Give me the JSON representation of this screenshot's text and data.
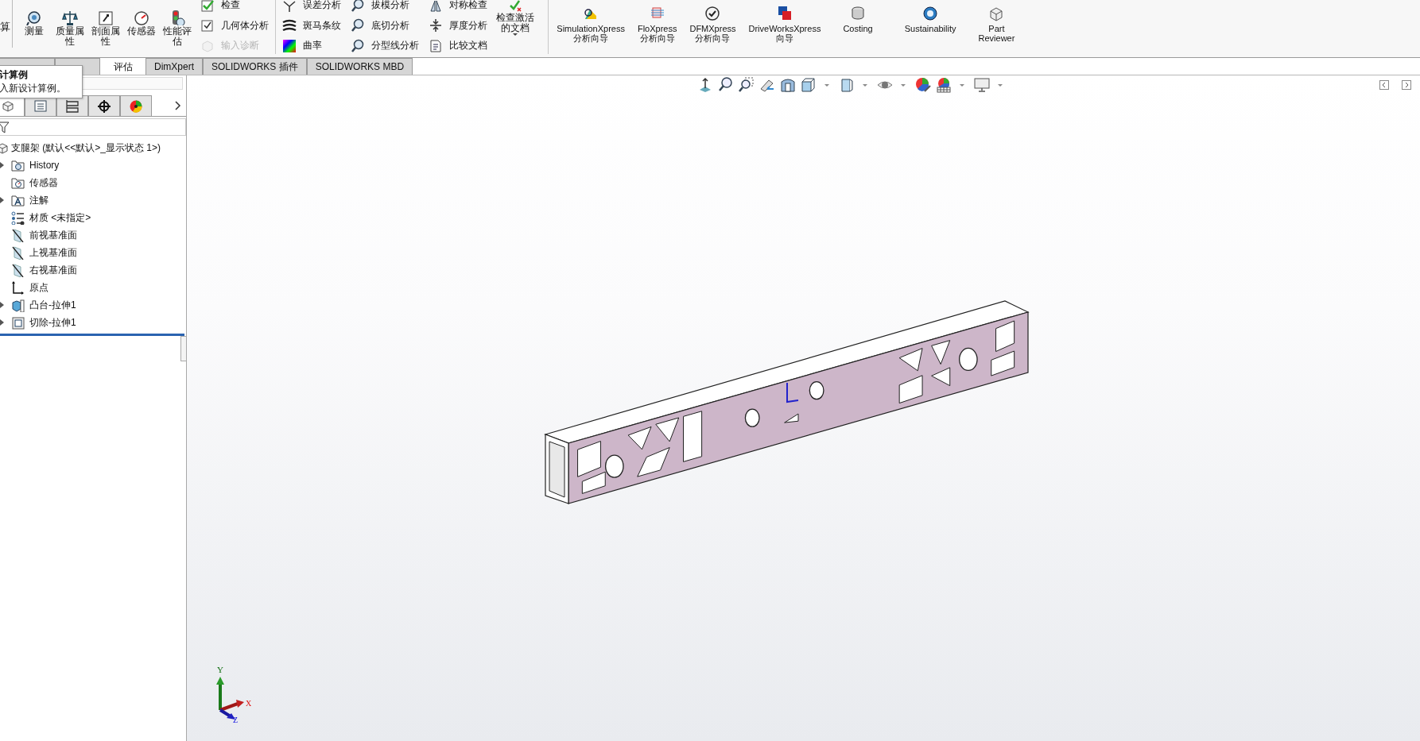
{
  "ribbon": {
    "cut_label": "算",
    "large_tools": [
      {
        "label": "测量",
        "kind": "measure"
      },
      {
        "label": "质量属性",
        "kind": "mass"
      },
      {
        "label": "剖面属性",
        "kind": "section"
      },
      {
        "label": "传感器",
        "kind": "sensor"
      },
      {
        "label": "性能评估",
        "kind": "performance"
      }
    ],
    "small_columns": [
      [
        {
          "label": "检查",
          "kind": "check",
          "disabled": false
        },
        {
          "label": "几何体分析",
          "kind": "geometry",
          "disabled": false
        },
        {
          "label": "输入诊断",
          "kind": "diagnose",
          "disabled": true
        }
      ],
      [
        {
          "label": "误差分析",
          "kind": "deviation",
          "disabled": false
        },
        {
          "label": "斑马条纹",
          "kind": "zebra",
          "disabled": false
        },
        {
          "label": "曲率",
          "kind": "curvature",
          "disabled": false
        }
      ],
      [
        {
          "label": "拔模分析",
          "kind": "magnifier",
          "disabled": false
        },
        {
          "label": "底切分析",
          "kind": "magnifier",
          "disabled": false
        },
        {
          "label": "分型线分析",
          "kind": "magnifier",
          "disabled": false
        }
      ],
      [
        {
          "label": "对称检查",
          "kind": "symmetry",
          "disabled": false
        },
        {
          "label": "厚度分析",
          "kind": "thickness",
          "disabled": false
        },
        {
          "label": "比较文档",
          "kind": "compare",
          "disabled": false
        }
      ]
    ],
    "check_doc": {
      "label": "检查激活的文档"
    },
    "xpress_tools": [
      {
        "label": "SimulationXpress 分析向导",
        "kind": "simulation"
      },
      {
        "label": "FloXpress 分析向导",
        "kind": "flow"
      },
      {
        "label": "DFMXpress 分析向导",
        "kind": "dfm"
      },
      {
        "label": "DriveWorksXpress 向导",
        "kind": "drive"
      },
      {
        "label": "Costing",
        "kind": "costing"
      },
      {
        "label": "Sustainability",
        "kind": "sustainability"
      },
      {
        "label": "Part Reviewer",
        "kind": "reviewer"
      }
    ]
  },
  "command_tabs": [
    {
      "selected": false
    },
    {
      "selected": false
    },
    {
      "label": "评估",
      "selected": true
    },
    {
      "label": "DimXpert",
      "selected": false
    },
    {
      "label": "SOLIDWORKS 插件",
      "selected": false
    },
    {
      "label": "SOLIDWORKS MBD",
      "selected": false
    }
  ],
  "tooltip": {
    "title": "计算例",
    "text": "入新设计算例。"
  },
  "feature_manager": {
    "tabs": [
      {
        "kind": "feature",
        "selected": true
      },
      {
        "kind": "property",
        "selected": false
      },
      {
        "kind": "config",
        "selected": false
      },
      {
        "kind": "dimxpert",
        "selected": false
      },
      {
        "kind": "display",
        "selected": false
      }
    ],
    "tree": {
      "label": "支腿架  (默认<<默认>_显示状态 1>)",
      "kind": "part",
      "children": [
        {
          "label": "History",
          "kind": "history",
          "expanded": false
        },
        {
          "label": "传感器",
          "kind": "sensor"
        },
        {
          "label": "注解",
          "kind": "annotation",
          "expanded": false
        },
        {
          "label": "材质 <未指定>",
          "kind": "material"
        },
        {
          "label": "前视基准面",
          "kind": "plane"
        },
        {
          "label": "上视基准面",
          "kind": "plane"
        },
        {
          "label": "右视基准面",
          "kind": "plane"
        },
        {
          "label": "原点",
          "kind": "origin"
        },
        {
          "label": "凸台-拉伸1",
          "kind": "boss",
          "expanded": false
        },
        {
          "label": "切除-拉伸1",
          "kind": "cut",
          "expanded": false
        }
      ]
    }
  },
  "triad": {
    "x": "X",
    "y": "Y",
    "z": "Z"
  }
}
